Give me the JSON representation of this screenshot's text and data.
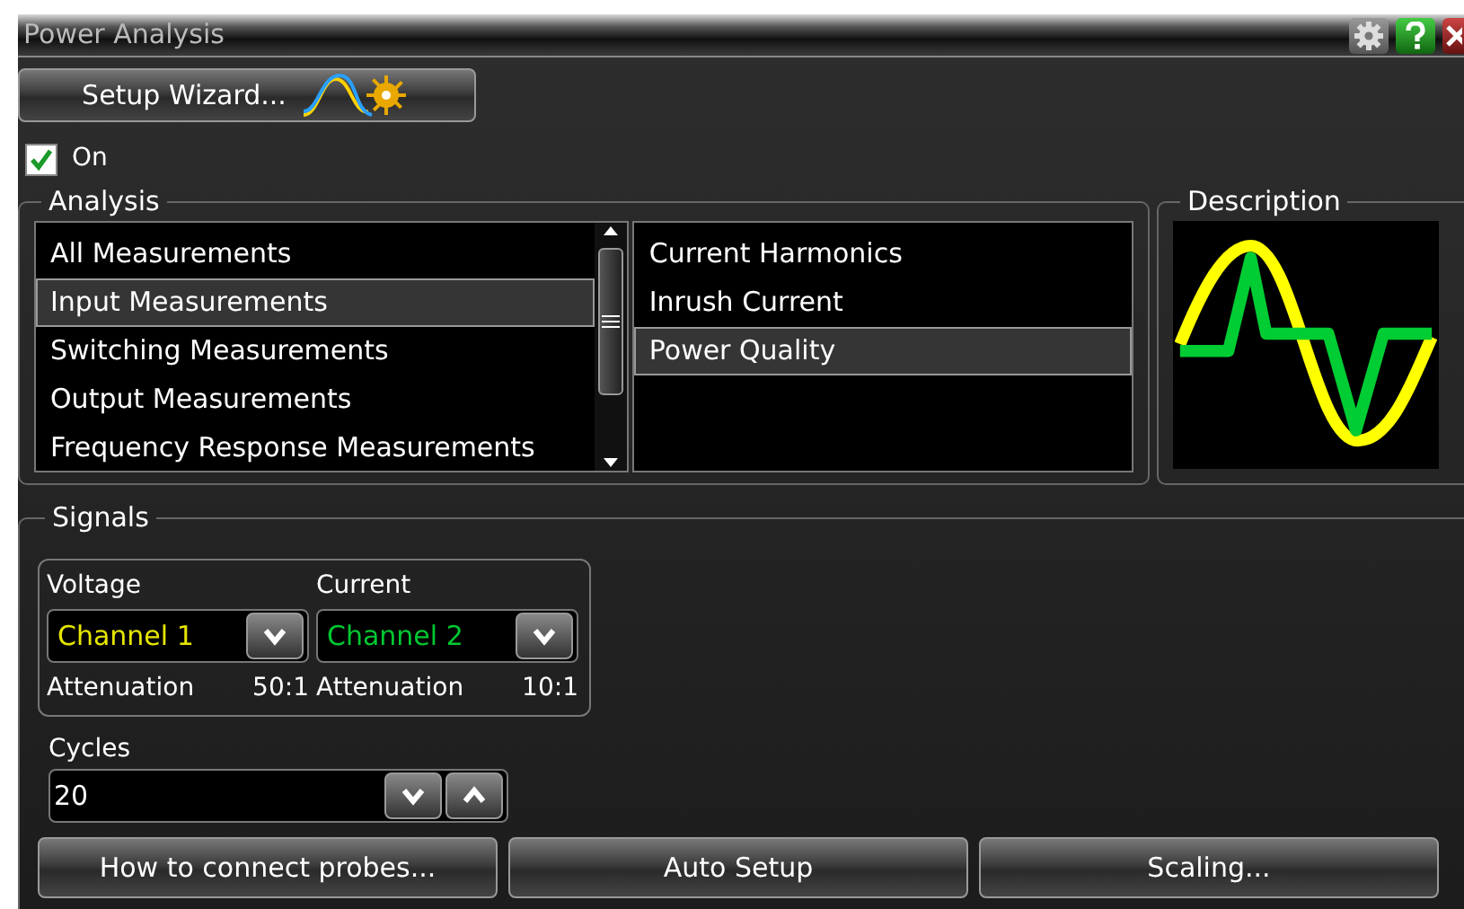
{
  "window": {
    "title": "Power Analysis"
  },
  "setup_wizard": {
    "label": "Setup Wizard..."
  },
  "enable": {
    "label": "On",
    "checked": true
  },
  "analysis": {
    "title": "Analysis",
    "categories": [
      {
        "label": "All Measurements",
        "selected": false
      },
      {
        "label": "Input Measurements",
        "selected": true
      },
      {
        "label": "Switching Measurements",
        "selected": false
      },
      {
        "label": "Output Measurements",
        "selected": false
      },
      {
        "label": "Frequency Response Measurements",
        "selected": false
      }
    ],
    "measurements": [
      {
        "label": "Current Harmonics",
        "selected": false
      },
      {
        "label": "Inrush Current",
        "selected": false
      },
      {
        "label": "Power Quality",
        "selected": true
      }
    ]
  },
  "description": {
    "title": "Description"
  },
  "signals": {
    "title": "Signals",
    "channels": [
      {
        "label": "Voltage",
        "value": "Channel 1",
        "color": "#e6e600",
        "attenuation_label": "Attenuation",
        "attenuation": "50:1"
      },
      {
        "label": "Current",
        "value": "Channel 2",
        "color": "#00c832",
        "attenuation_label": "Attenuation",
        "attenuation": "10:1"
      }
    ],
    "cycles": {
      "label": "Cycles",
      "value": "20"
    }
  },
  "buttons": [
    "How to connect probes...",
    "Auto Setup",
    "Scaling..."
  ]
}
